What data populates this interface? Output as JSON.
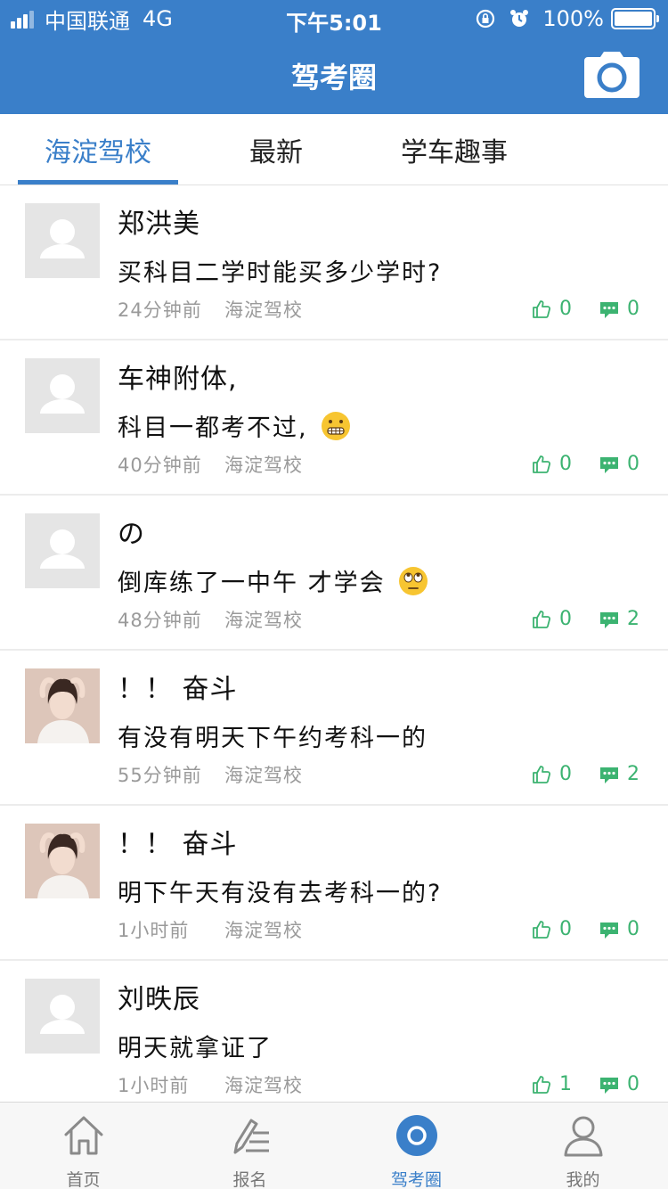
{
  "status_bar": {
    "carrier": "中国联通",
    "network": "4G",
    "time": "下午5:01",
    "battery": "100%"
  },
  "nav": {
    "title": "驾考圈"
  },
  "tabs": [
    {
      "label": "海淀驾校",
      "active": true
    },
    {
      "label": "最新",
      "active": false
    },
    {
      "label": "学车趣事",
      "active": false
    }
  ],
  "posts": [
    {
      "author": "郑洪美",
      "content": "买科目二学时能买多少学时?",
      "time": "24分钟前",
      "school": "海淀驾校",
      "likes": "0",
      "comments": "0"
    },
    {
      "author": "车神附体,",
      "content": "科目一都考不过,",
      "time": "40分钟前",
      "school": "海淀驾校",
      "likes": "0",
      "comments": "0"
    },
    {
      "author": "の",
      "content": "倒库练了一中午 才学会",
      "time": "48分钟前",
      "school": "海淀驾校",
      "likes": "0",
      "comments": "2"
    },
    {
      "author": "！！ 奋斗",
      "content": "有没有明天下午约考科一的",
      "time": "55分钟前",
      "school": "海淀驾校",
      "likes": "0",
      "comments": "2"
    },
    {
      "author": "！！ 奋斗",
      "content": "明下午天有没有去考科一的?",
      "time": "1小时前",
      "school": "海淀驾校",
      "likes": "0",
      "comments": "0"
    },
    {
      "author": "刘昳辰",
      "content": "明天就拿证了",
      "time": "1小时前",
      "school": "海淀驾校",
      "likes": "1",
      "comments": "0"
    }
  ],
  "tabbar": [
    {
      "label": "首页",
      "icon": "home-icon"
    },
    {
      "label": "报名",
      "icon": "pencil-list-icon"
    },
    {
      "label": "驾考圈",
      "icon": "circle-icon",
      "active": true
    },
    {
      "label": "我的",
      "icon": "user-icon"
    }
  ],
  "colors": {
    "primary": "#3a7fc9",
    "action_green": "#3cb371",
    "meta_gray": "#9a9a9a"
  }
}
